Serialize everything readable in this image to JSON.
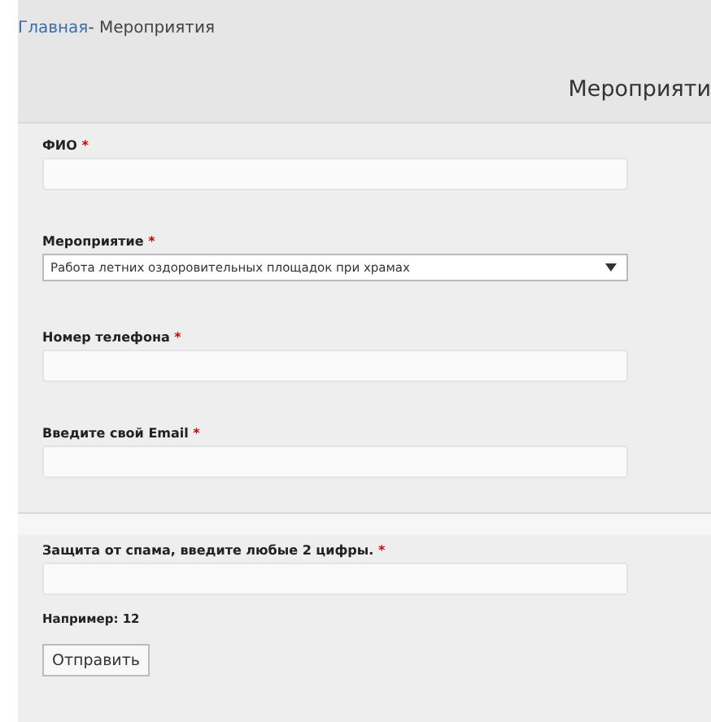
{
  "breadcrumb": {
    "home": "Главная",
    "separator": "-",
    "current": " Мероприятия"
  },
  "heading": "Мероприяти",
  "fields": [
    {
      "kind": "text",
      "label": "ФИО",
      "required_mark": "*"
    },
    {
      "kind": "select",
      "label": "Мероприятие",
      "required_mark": "*",
      "value": "Работа летних оздоровительных площадок при храмах"
    },
    {
      "kind": "text",
      "label": "Номер телефона",
      "required_mark": "*"
    },
    {
      "kind": "text",
      "label": "Введите свой Email",
      "required_mark": "*"
    }
  ],
  "spam": {
    "label": "Защита от спама, введите любые 2 цифры.",
    "required_mark": "*",
    "hint": "Например: 12"
  },
  "submit": "Отправить"
}
